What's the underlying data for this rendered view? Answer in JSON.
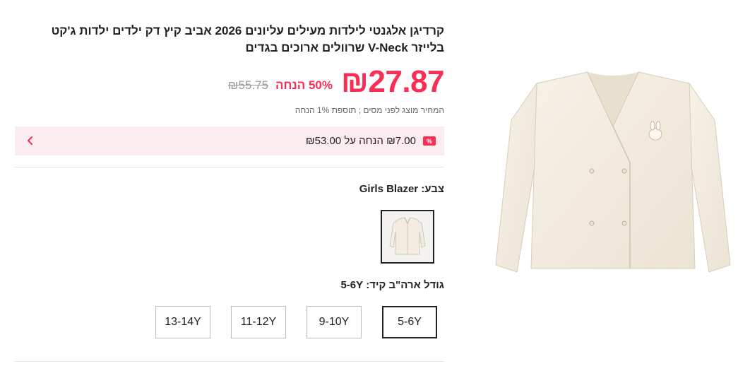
{
  "product": {
    "title": "קרדיגן אלגנטי לילדות מעילים עליונים 2026 אביב קיץ דק ילדים ילדות ג'קט בלייזר V-Neck שרוולים ארוכים בגדים"
  },
  "price": {
    "current": "₪27.87",
    "discount": "50% הנחה",
    "original": "₪55.75",
    "tax_note": "המחיר מוצג לפני מסים ; תוספת 1% הנחה"
  },
  "promo": {
    "badge": "%",
    "text": "₪7.00 הנחה על ₪53.00",
    "icon": "chevron-left-icon"
  },
  "color": {
    "label": "צבע:",
    "value": "Girls Blazer"
  },
  "size": {
    "label": "גודל ארה\"ב קיד:",
    "value": "5-6Y",
    "options": [
      "5-6Y",
      "9-10Y",
      "11-12Y",
      "13-14Y"
    ],
    "selected": "5-6Y"
  },
  "colors": {
    "accent": "#fa2d55",
    "promo_bg": "#fdecef",
    "garment": "#f3ece0"
  }
}
